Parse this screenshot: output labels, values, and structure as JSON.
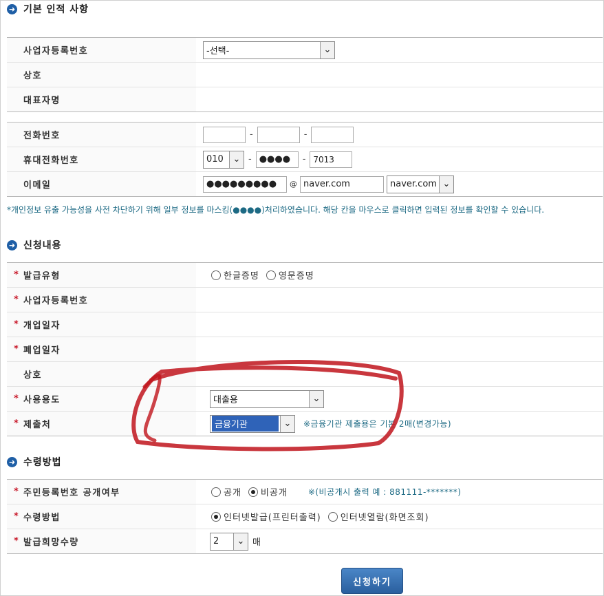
{
  "sections": {
    "basic": "기본 인적 사항",
    "request": "신청내용",
    "receipt": "수령방법"
  },
  "basic_rows": {
    "biz_no_label": "사업자등록번호",
    "biz_no_select": "-선택-",
    "company_label": "상호",
    "ceo_label": "대표자명"
  },
  "contact_rows": {
    "phone_label": "전화번호",
    "phone_parts": [
      "",
      "",
      ""
    ],
    "mobile_label": "휴대전화번호",
    "mobile_prefix": "010",
    "mobile_middle": "●●●●",
    "mobile_last": "7013",
    "email_label": "이메일",
    "email_id": "●●●●●●●●●",
    "email_at": "@",
    "email_domain": "naver.com",
    "email_domain_select": "naver.com",
    "dash": "-"
  },
  "notice": "*개인정보 유출 가능성을 사전 차단하기 위해 일부 정보를 마스킹(●●●●)처리하였습니다. 해당 칸을 마우스로 클릭하면 입력된 정보를 확인할 수 있습니다.",
  "request_rows": {
    "required_mark": "*",
    "issue_type_label": "발급유형",
    "issue_type_options": [
      "한글증명",
      "영문증명"
    ],
    "biz_no_label": "사업자등록번호",
    "open_date_label": "개업일자",
    "close_date_label": "폐업일자",
    "company_label": "상호",
    "purpose_label": "사용용도",
    "purpose_value": "대출용",
    "submit_to_label": "제출처",
    "submit_to_value": "금융기관",
    "submit_to_note": "※금융기관 제출용은 기본 2매(변경가능)"
  },
  "receipt_rows": {
    "ssn_label": "주민등록번호 공개여부",
    "ssn_options": [
      "공개",
      "비공개"
    ],
    "ssn_note": "※(비공개시 출력 예 : 881111-*******)",
    "method_label": "수령방법",
    "method_options": [
      "인터넷발급(프린터출력)",
      "인터넷열람(화면조회)"
    ],
    "qty_label": "발급희망수량",
    "qty_value": "2",
    "qty_unit": "매"
  },
  "submit_button": "신청하기",
  "colors": {
    "accent": "#1f5fa6",
    "required": "#c8192a",
    "note": "#1d6a84",
    "scribble": "#c0141c"
  }
}
